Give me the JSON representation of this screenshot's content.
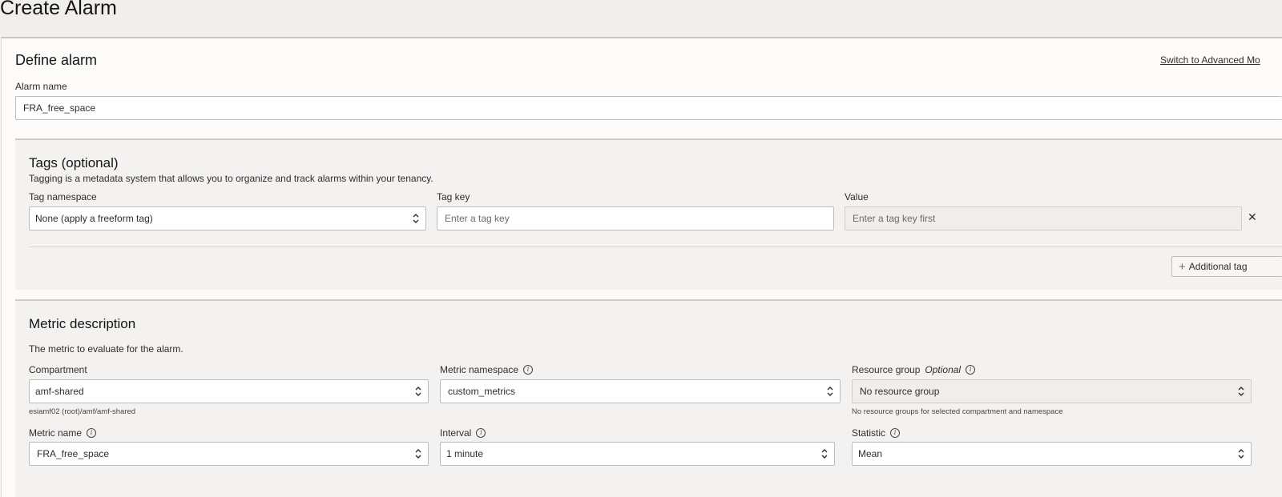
{
  "page": {
    "title": "Create Alarm"
  },
  "define_alarm": {
    "heading": "Define alarm",
    "switch_link": "Switch to Advanced Mo",
    "alarm_name_label": "Alarm name",
    "alarm_name_value": "FRA_free_space"
  },
  "tags": {
    "heading": "Tags (optional)",
    "description": "Tagging is a metadata system that allows you to organize and track alarms within your tenancy.",
    "namespace_label": "Tag namespace",
    "namespace_value": "None (apply a freeform tag)",
    "key_label": "Tag key",
    "key_placeholder": "Enter a tag key",
    "value_label": "Value",
    "value_placeholder": "Enter a tag key first",
    "remove_glyph": "✕",
    "add_button_label": "Additional tag",
    "add_glyph": "+"
  },
  "metric": {
    "heading": "Metric description",
    "description": "The metric to evaluate for the alarm.",
    "compartment_label": "Compartment",
    "compartment_value": "amf-shared",
    "compartment_hint": "esiamf02 (root)/amf/amf-shared",
    "namespace_label": "Metric namespace",
    "namespace_value": "custom_metrics",
    "resource_group_label": "Resource group",
    "resource_group_optional": "Optional",
    "resource_group_value": "No resource group",
    "resource_group_hint": "No resource groups for selected compartment and namespace",
    "metric_name_label": "Metric name",
    "metric_name_value": "FRA_free_space",
    "interval_label": "Interval",
    "interval_value": "1 minute",
    "statistic_label": "Statistic",
    "statistic_value": "Mean",
    "info_glyph": "i"
  }
}
